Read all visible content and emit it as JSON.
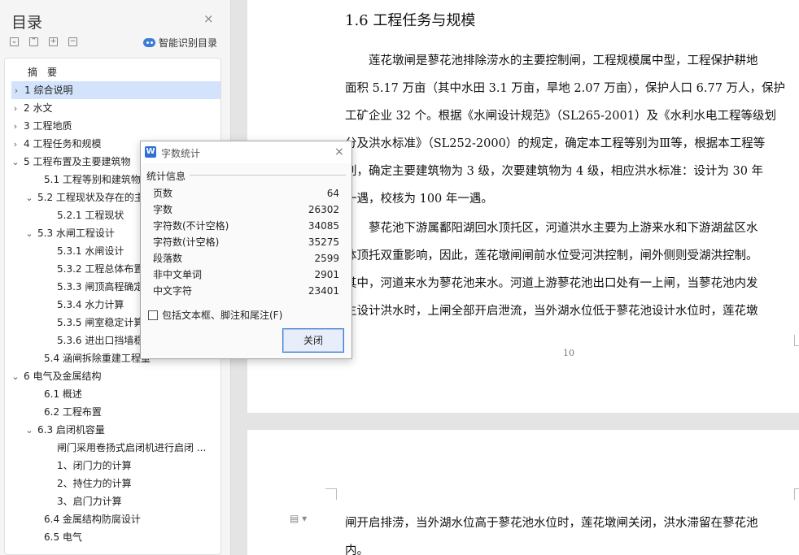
{
  "toc": {
    "title": "目录",
    "close_glyph": "×",
    "smart_toc_label": "智能识别目录",
    "items": [
      {
        "label": "摘　要",
        "level": 0,
        "chevron": ""
      },
      {
        "label": "1  综合说明",
        "level": 0,
        "chevron": "›",
        "selected": true
      },
      {
        "label": "2  水文",
        "level": 0,
        "chevron": "›"
      },
      {
        "label": "3  工程地质",
        "level": 0,
        "chevron": "›"
      },
      {
        "label": "4  工程任务和规模",
        "level": 0,
        "chevron": "›"
      },
      {
        "label": "5  工程布置及主要建筑物",
        "level": 0,
        "chevron": "⌄"
      },
      {
        "label": "5.1  工程等别和建筑物",
        "level": 1,
        "chevron": ""
      },
      {
        "label": "5.2  工程现状及存在的主",
        "level": 1,
        "chevron": "⌄"
      },
      {
        "label": "5.2.1  工程现状",
        "level": 2,
        "chevron": ""
      },
      {
        "label": "5.3  水闸工程设计",
        "level": 1,
        "chevron": "⌄"
      },
      {
        "label": "5.3.1 水闸设计",
        "level": 2,
        "chevron": ""
      },
      {
        "label": "5.3.2  工程总体布置",
        "level": 2,
        "chevron": ""
      },
      {
        "label": "5.3.3  闸顶高程确定",
        "level": 2,
        "chevron": ""
      },
      {
        "label": "5.3.4  水力计算",
        "level": 2,
        "chevron": ""
      },
      {
        "label": "5.3.5  闸室稳定计算",
        "level": 2,
        "chevron": ""
      },
      {
        "label": "5.3.6  进出口挡墙稳",
        "level": 2,
        "chevron": ""
      },
      {
        "label": "5.4  涵闸拆除重建工程量",
        "level": 1,
        "chevron": ""
      },
      {
        "label": "6  电气及金属结构",
        "level": 0,
        "chevron": "⌄"
      },
      {
        "label": "6.1 概述",
        "level": 1,
        "chevron": ""
      },
      {
        "label": "6.2 工程布置",
        "level": 1,
        "chevron": ""
      },
      {
        "label": "6.3 启闭机容量",
        "level": 1,
        "chevron": "⌄"
      },
      {
        "label": "闸门采用卷扬式启闭机进行启闭 ...",
        "level": 2,
        "chevron": ""
      },
      {
        "label": "1、闭门力的计算",
        "level": 2,
        "chevron": ""
      },
      {
        "label": "2、持住力的计算",
        "level": 2,
        "chevron": ""
      },
      {
        "label": "3、启门力计算",
        "level": 2,
        "chevron": ""
      },
      {
        "label": "6.4 金属结构防腐设计",
        "level": 1,
        "chevron": ""
      },
      {
        "label": "6.5 电气",
        "level": 1,
        "chevron": ""
      }
    ]
  },
  "document": {
    "heading": "1.6  工程任务与规模",
    "page1_lines": [
      "　　莲花墩闸是蓼花池排除涝水的主要控制闸，工程规模属中型，工程保护耕地",
      "面积 5.17 万亩（其中水田 3.1 万亩，旱地 2.07 万亩），保护人口 6.77 万人，保护",
      "工矿企业 32 个。根据《水闸设计规范》（SL265-2001）及《水利水电工程等级划",
      "分及洪水标准》（SL252-2000）的规定，确定本工程等别为Ⅲ等，根据本工程等",
      "别，确定主要建筑物为 3 级，次要建筑物为 4 级，相应洪水标准：设计为 30 年",
      "一遇，校核为 100 年一遇。",
      "　　蓼花池下游属鄱阳湖回水顶托区，河道洪水主要为上游来水和下游湖盆区水",
      "体顶托双重影响，因此，莲花墩闸闸前水位受河洪控制，闸外侧则受湖洪控制。",
      "其中，河道来水为蓼花池来水。河道上游蓼花池出口处有一上闸，当蓼花池内发",
      "生设计洪水时，上闸全部开启泄流，当外湖水位低于蓼花池设计水位时，莲花墩"
    ],
    "page_number": "10",
    "page2_lines": [
      "闸开启排涝，当外湖水位高于蓼花池水位时，莲花墩闸关闭，洪水滞留在蓼花池",
      "内。"
    ],
    "side_icon": "document-options-icon"
  },
  "dialog": {
    "title": "字数统计",
    "logo_glyph": "W",
    "close_glyph": "×",
    "section_label": "统计信息",
    "stats": [
      {
        "label": "页数",
        "value": "64"
      },
      {
        "label": "字数",
        "value": "26302"
      },
      {
        "label": "字符数(不计空格)",
        "value": "34085"
      },
      {
        "label": "字符数(计空格)",
        "value": "35275"
      },
      {
        "label": "段落数",
        "value": "2599"
      },
      {
        "label": "非中文单词",
        "value": "2901"
      },
      {
        "label": "中文字符",
        "value": "23401"
      }
    ],
    "checkbox_label": "包括文本框、脚注和尾注(F)",
    "checkbox_checked": false,
    "close_button_label": "关闭"
  },
  "colors": {
    "accent": "#3c78d8",
    "selection": "#d3e3fb",
    "pane_bg": "#f5f5f5"
  }
}
